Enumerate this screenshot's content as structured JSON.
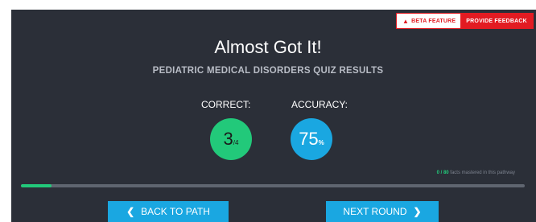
{
  "beta": {
    "label": "BETA FEATURE",
    "icon": "megaphone-icon",
    "feedback_button": "PROVIDE FEEDBACK"
  },
  "results": {
    "title": "Almost Got It!",
    "subtitle": "PEDIATRIC MEDICAL DISORDERS QUIZ RESULTS",
    "correct": {
      "label": "CORRECT:",
      "value": "3",
      "denominator": "/4"
    },
    "accuracy": {
      "label": "ACCURACY:",
      "value": "75",
      "unit": "%"
    }
  },
  "progress": {
    "mastered": "0 / 80",
    "mastered_text": " facts mastered in this pathway",
    "fraction": 0.06
  },
  "nav": {
    "back_label": "BACK TO PATH",
    "back_icon": "chevron-left-icon",
    "next_label": "NEXT ROUND",
    "next_icon": "chevron-right-icon"
  },
  "colors": {
    "panel": "#2b2f38",
    "green": "#22c97a",
    "blue": "#1aa7e1",
    "red": "#e21b22"
  }
}
